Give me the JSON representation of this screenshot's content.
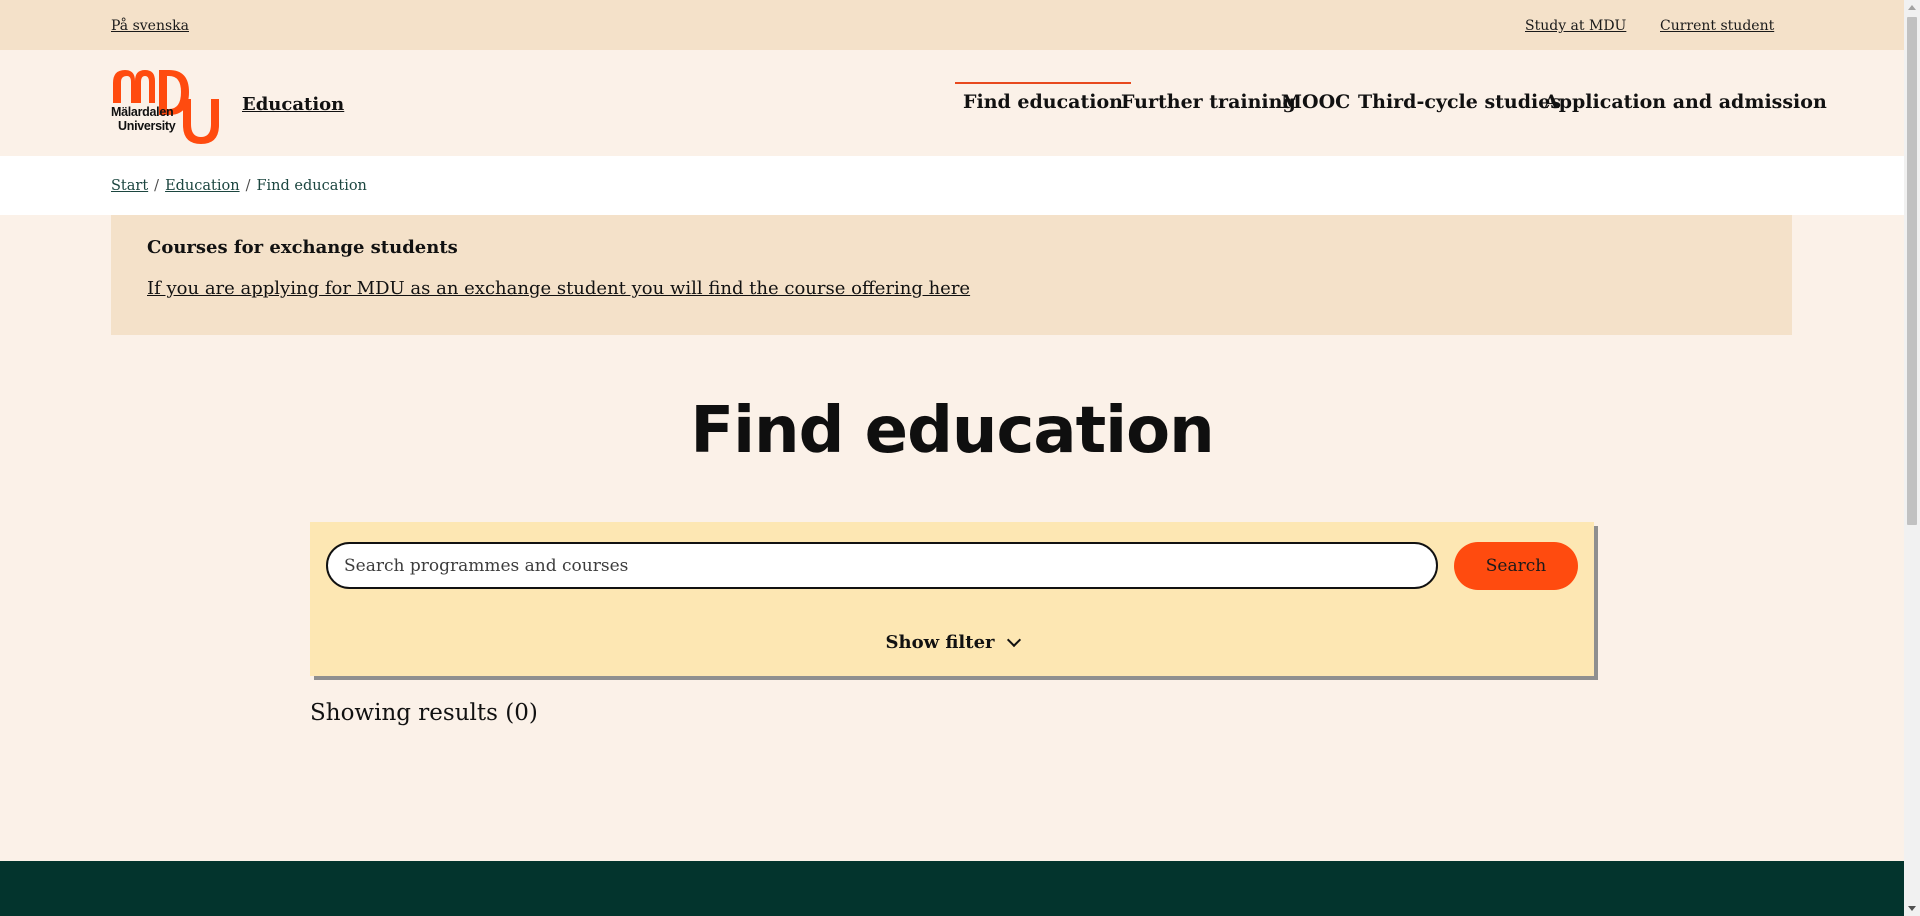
{
  "topbar": {
    "language_link": "På svenska",
    "links": [
      "Study at MDU",
      "Current student"
    ]
  },
  "header": {
    "logo_wordmark_line1": "Mälardalen",
    "logo_wordmark_line2": "University",
    "site_title": "Education",
    "nav": [
      {
        "label": "Find education",
        "active": true
      },
      {
        "label": "Further training",
        "active": false
      },
      {
        "label": "MOOC",
        "active": false
      },
      {
        "label": "Third-cycle studies",
        "active": false
      },
      {
        "label": "Application and admission",
        "active": false
      }
    ]
  },
  "breadcrumb": {
    "items": [
      "Start",
      "Education"
    ],
    "current": "Find education",
    "separator": "/"
  },
  "notice": {
    "heading": "Courses for exchange students",
    "link": "If you are applying for MDU as an exchange student you will find the course offering here"
  },
  "main": {
    "title": "Find education",
    "search": {
      "placeholder": "Search programmes and courses",
      "value": "",
      "button": "Search"
    },
    "filter_toggle": "Show filter",
    "results": "Showing results (0)"
  },
  "colors": {
    "accent": "#ff4b0f",
    "topbar_bg": "#f4e1c9",
    "page_bg": "#fbf1e8",
    "search_panel_bg": "#fde7b3",
    "footer_bg": "#03342d"
  }
}
